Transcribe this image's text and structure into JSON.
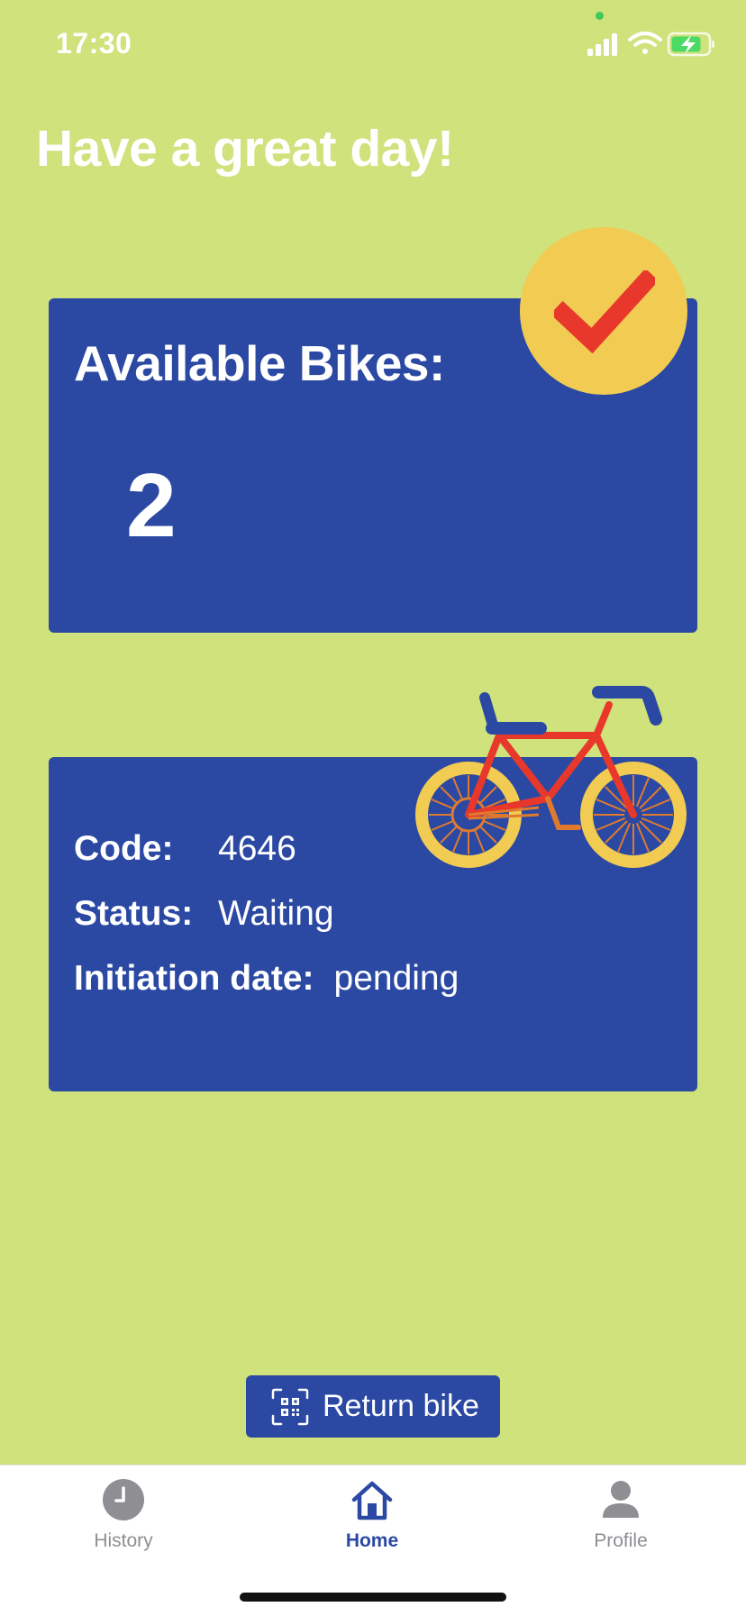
{
  "status_bar": {
    "time": "17:30",
    "icons": [
      "signal-icon",
      "wifi-icon",
      "battery-charging-icon"
    ]
  },
  "greeting": "Have a great day!",
  "available_card": {
    "title": "Available Bikes:",
    "count": "2",
    "badge_icon": "checkmark-icon"
  },
  "booking_card": {
    "illustration": "bicycle-icon",
    "code": {
      "label": "Code:",
      "value": "4646"
    },
    "status": {
      "label": "Status:",
      "value": "Waiting"
    },
    "initiation_date": {
      "label": "Initiation date:",
      "value": "pending"
    }
  },
  "return_button": {
    "label": "Return bike",
    "icon": "qr-code-scan-icon"
  },
  "tab_bar": {
    "items": [
      {
        "label": "History",
        "icon": "clock-icon",
        "active": false
      },
      {
        "label": "Home",
        "icon": "home-icon",
        "active": true
      },
      {
        "label": "Profile",
        "icon": "person-icon",
        "active": false
      }
    ]
  },
  "colors": {
    "background": "#cfe27b",
    "card": "#2b49a3",
    "badge": "#f1cb52",
    "check": "#e8382b",
    "tab_active": "#2b49a3",
    "tab_inactive": "#8e8e93"
  }
}
